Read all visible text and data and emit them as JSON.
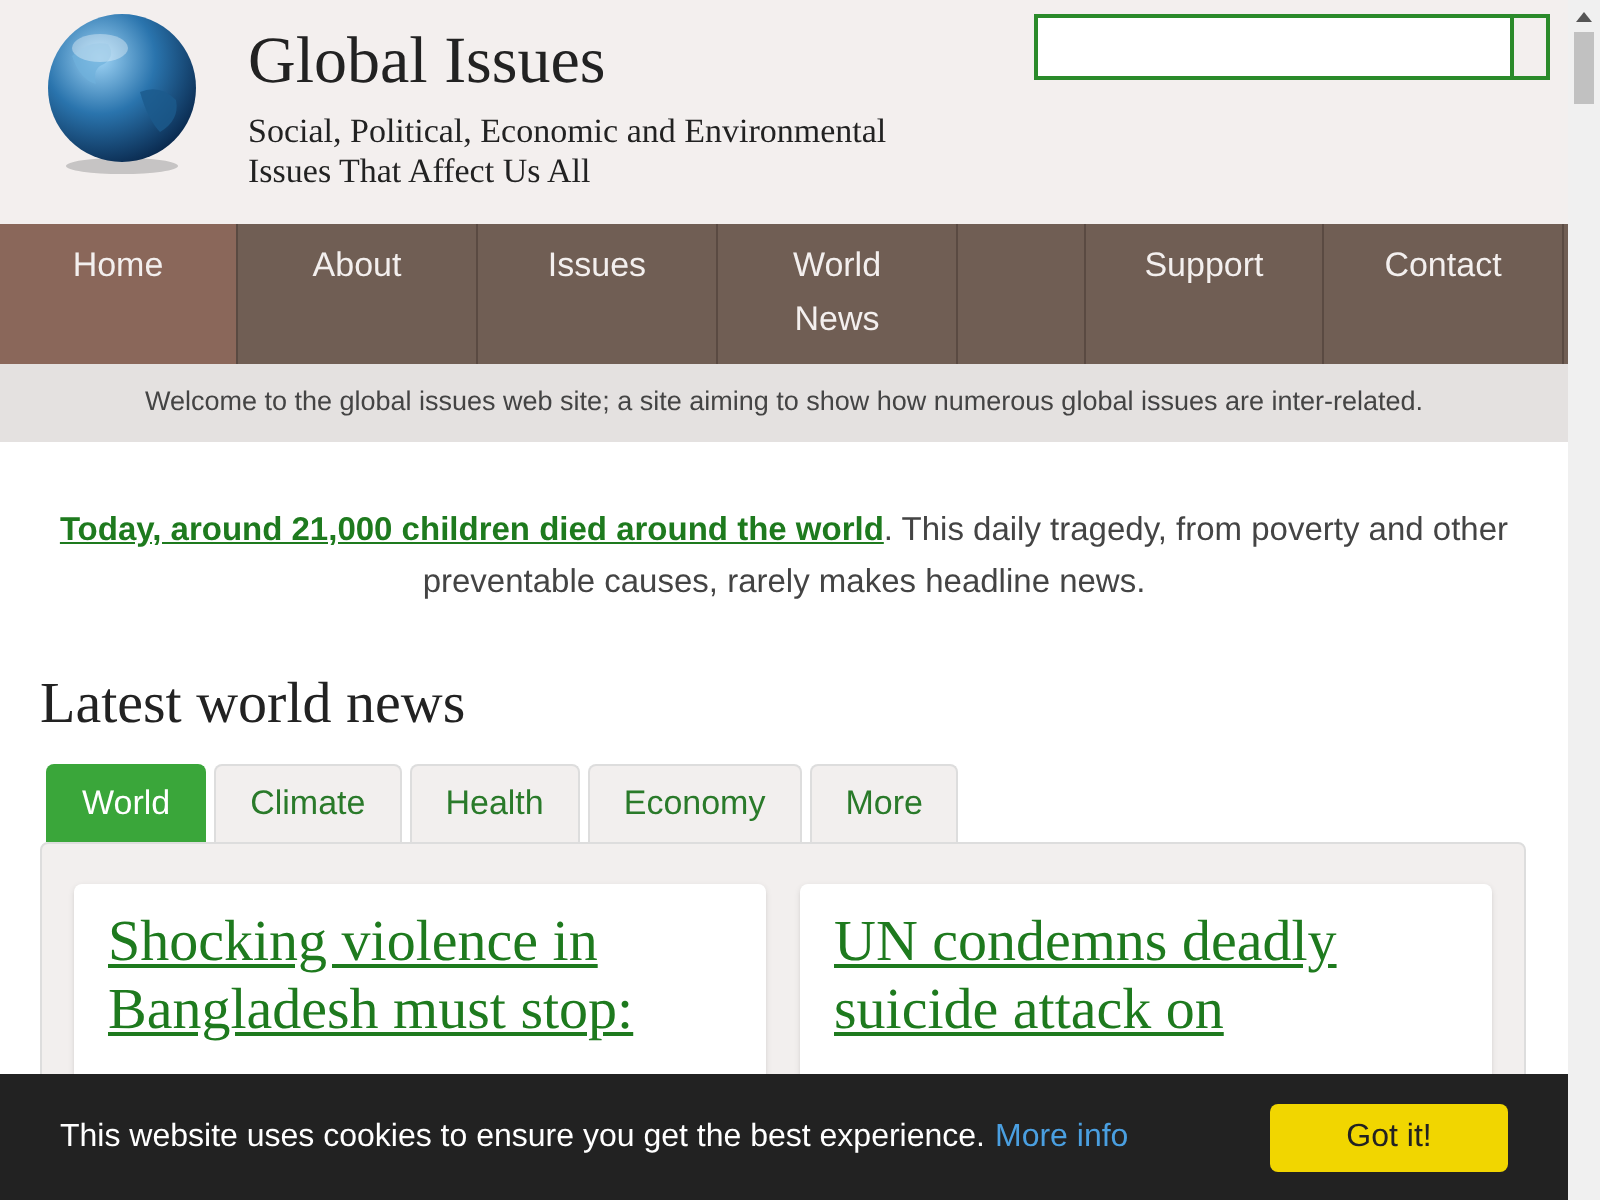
{
  "site": {
    "title": "Global Issues",
    "tagline": "Social, Political, Economic and Environmental Issues That Affect Us All"
  },
  "nav": [
    {
      "label": "Home",
      "selected": true
    },
    {
      "label": "About",
      "selected": false
    },
    {
      "label": "Issues",
      "selected": false
    },
    {
      "label": "World News",
      "selected": false
    },
    {
      "kind": "spacer",
      "selected": false
    },
    {
      "label": "Support",
      "selected": false
    },
    {
      "label": "Contact",
      "selected": false
    }
  ],
  "welcome": "Welcome to the global issues web site; a site aiming to show how numerous global issues are inter-related.",
  "intro": {
    "link": "Today, around 21,000 children died around the world",
    "text": ". This daily tragedy, from poverty and other preventable causes, rarely makes headline news."
  },
  "news": {
    "heading": "Latest world news",
    "tabs": [
      {
        "label": "World",
        "selected": true
      },
      {
        "label": "Climate",
        "selected": false
      },
      {
        "label": "Health",
        "selected": false
      },
      {
        "label": "Economy",
        "selected": false
      },
      {
        "label": "More",
        "selected": false
      }
    ],
    "articles": [
      {
        "title": "Shocking violence in Bangladesh must stop:"
      },
      {
        "title": "UN condemns deadly suicide attack on"
      }
    ]
  },
  "cookie_bar": {
    "message": "This website uses cookies to ensure you get the best experience.",
    "link": "More info",
    "button": "Got it!"
  }
}
